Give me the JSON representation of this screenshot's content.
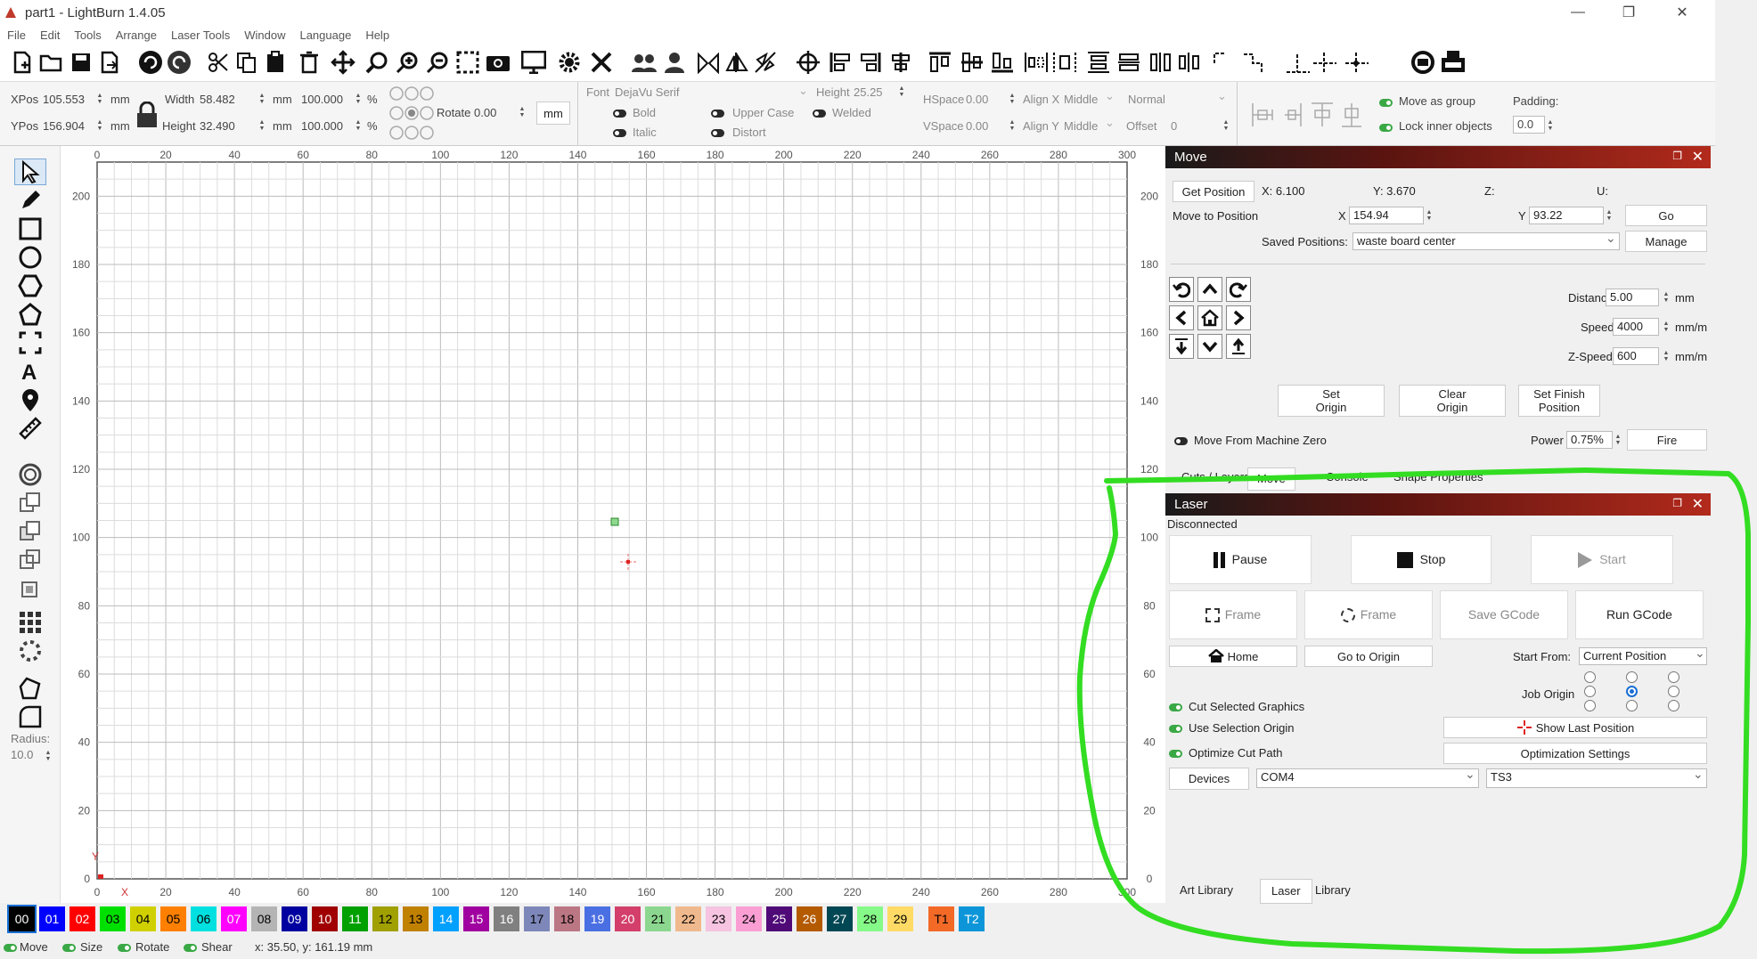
{
  "window": {
    "title": "part1 - LightBurn 1.4.05",
    "minimize": "—",
    "maximize": "❐",
    "close": "✕"
  },
  "menu": [
    "File",
    "Edit",
    "Tools",
    "Arrange",
    "Laser Tools",
    "Window",
    "Language",
    "Help"
  ],
  "props": {
    "xpos_label": "XPos",
    "xpos": "105.553",
    "ypos_label": "YPos",
    "ypos": "156.904",
    "unit": "mm",
    "width_label": "Width",
    "width": "58.482",
    "height_label": "Height",
    "height": "32.490",
    "scale_w": "100.000",
    "scale_h": "100.000",
    "pct": "%",
    "rotate_label": "Rotate",
    "rotate": "0.00",
    "unit_button": "mm",
    "font_label": "Font",
    "font": "DejaVu Serif",
    "text_height_label": "Height",
    "text_height": "25.25",
    "hspace_label": "HSpace",
    "hspace": "0.00",
    "vspace_label": "VSpace",
    "vspace": "0.00",
    "alignx_label": "Align X",
    "alignx": "Middle",
    "aligny_label": "Align Y",
    "aligny": "Middle",
    "normal": "Normal",
    "offset_label": "Offset",
    "offset": "0",
    "bold": "Bold",
    "italic": "Italic",
    "upper_case": "Upper Case",
    "distort": "Distort",
    "welded": "Welded",
    "move_as_group": "Move as group",
    "lock_inner": "Lock inner objects",
    "padding_label": "Padding:",
    "padding": "0.0"
  },
  "canvas": {
    "x_ticks": [
      "0",
      "20",
      "40",
      "60",
      "80",
      "100",
      "120",
      "140",
      "160",
      "180",
      "200",
      "220",
      "240",
      "260",
      "280",
      "300"
    ],
    "y_ticks": [
      "200",
      "180",
      "160",
      "140",
      "120",
      "100",
      "80",
      "60",
      "40",
      "20",
      "0"
    ],
    "x_axis_label": "X",
    "y_axis_label": "Y"
  },
  "lefttools": {
    "radius_label": "Radius:",
    "radius": "10.0"
  },
  "palette": [
    {
      "label": "00",
      "bg": "#000000",
      "fg": "#ffffff"
    },
    {
      "label": "01",
      "bg": "#0000ff",
      "fg": "#ffffff"
    },
    {
      "label": "02",
      "bg": "#ff0000",
      "fg": "#ffffff"
    },
    {
      "label": "03",
      "bg": "#00e000",
      "fg": "#000000"
    },
    {
      "label": "04",
      "bg": "#d0d000",
      "fg": "#000000"
    },
    {
      "label": "05",
      "bg": "#ff8000",
      "fg": "#000000"
    },
    {
      "label": "06",
      "bg": "#00e0e0",
      "fg": "#000000"
    },
    {
      "label": "07",
      "bg": "#ff00ff",
      "fg": "#ffffff"
    },
    {
      "label": "08",
      "bg": "#b4b4b4",
      "fg": "#000000"
    },
    {
      "label": "09",
      "bg": "#0000a0",
      "fg": "#ffffff"
    },
    {
      "label": "10",
      "bg": "#a00000",
      "fg": "#ffffff"
    },
    {
      "label": "11",
      "bg": "#00a000",
      "fg": "#ffffff"
    },
    {
      "label": "12",
      "bg": "#a0a000",
      "fg": "#000000"
    },
    {
      "label": "13",
      "bg": "#c08000",
      "fg": "#000000"
    },
    {
      "label": "14",
      "bg": "#00a0ff",
      "fg": "#ffffff"
    },
    {
      "label": "15",
      "bg": "#a000a0",
      "fg": "#ffffff"
    },
    {
      "label": "16",
      "bg": "#808080",
      "fg": "#ffffff"
    },
    {
      "label": "17",
      "bg": "#7d87b9",
      "fg": "#000000"
    },
    {
      "label": "18",
      "bg": "#bb7784",
      "fg": "#000000"
    },
    {
      "label": "19",
      "bg": "#4a6fe3",
      "fg": "#ffffff"
    },
    {
      "label": "20",
      "bg": "#d33f6a",
      "fg": "#ffffff"
    },
    {
      "label": "21",
      "bg": "#8cd78f",
      "fg": "#000000"
    },
    {
      "label": "22",
      "bg": "#f0b98d",
      "fg": "#000000"
    },
    {
      "label": "23",
      "bg": "#f6c4e1",
      "fg": "#000000"
    },
    {
      "label": "24",
      "bg": "#fa9ed4",
      "fg": "#000000"
    },
    {
      "label": "25",
      "bg": "#500a78",
      "fg": "#ffffff"
    },
    {
      "label": "26",
      "bg": "#b45a00",
      "fg": "#ffffff"
    },
    {
      "label": "27",
      "bg": "#004754",
      "fg": "#ffffff"
    },
    {
      "label": "28",
      "bg": "#86fa88",
      "fg": "#000000"
    },
    {
      "label": "29",
      "bg": "#ffdb66",
      "fg": "#000000"
    },
    {
      "label": "T1",
      "bg": "#f36926",
      "fg": "#000000"
    },
    {
      "label": "T2",
      "bg": "#0c96d9",
      "fg": "#ffffff"
    }
  ],
  "status": {
    "move": "Move",
    "size": "Size",
    "rotate": "Rotate",
    "shear": "Shear",
    "coords": "x: 35.50, y: 161.19 mm"
  },
  "move_panel": {
    "title": "Move",
    "get_position": "Get Position",
    "x_readout": "X: 6.100",
    "y_readout": "Y: 3.670",
    "z_readout": "Z:",
    "u_readout": "U:",
    "move_to_label": "Move to Position",
    "x_label": "X",
    "x_value": "154.94",
    "y_label": "Y",
    "y_value": "93.22",
    "go": "Go",
    "saved_label": "Saved Positions:",
    "saved_value": "waste board center",
    "manage": "Manage",
    "distance_label": "Distance",
    "distance": "5.00",
    "distance_unit": "mm",
    "speed_label": "Speed",
    "speed": "4000",
    "speed_unit": "mm/m",
    "zspeed_label": "Z-Speed",
    "zspeed": "600",
    "zspeed_unit": "mm/m",
    "set_origin": "Set\nOrigin",
    "clear_origin": "Clear\nOrigin",
    "set_finish": "Set Finish\nPosition",
    "move_from_zero": "Move From Machine Zero",
    "power_label": "Power",
    "power": "0.75%",
    "fire": "Fire"
  },
  "tabs_top": [
    "Cuts / Layers",
    "Move",
    "Console",
    "Shape Properties"
  ],
  "laser_panel": {
    "title": "Laser",
    "status": "Disconnected",
    "pause": "Pause",
    "stop": "Stop",
    "start": "Start",
    "frame1": "Frame",
    "frame2": "Frame",
    "save_gcode": "Save GCode",
    "run_gcode": "Run GCode",
    "home": "Home",
    "go_to_origin": "Go to Origin",
    "start_from_label": "Start From:",
    "start_from": "Current Position",
    "job_origin_label": "Job Origin",
    "cut_selected": "Cut Selected Graphics",
    "use_selection_origin": "Use Selection Origin",
    "optimize_cut": "Optimize Cut Path",
    "show_last": "Show Last Position",
    "optimization_settings": "Optimization Settings",
    "devices": "Devices",
    "port": "COM4",
    "device": "TS3"
  },
  "tabs_bottom": [
    "Art Library",
    "Laser",
    "Library"
  ],
  "colors": {
    "annotation": "#33dd22",
    "accent": "#1a6fd4"
  }
}
